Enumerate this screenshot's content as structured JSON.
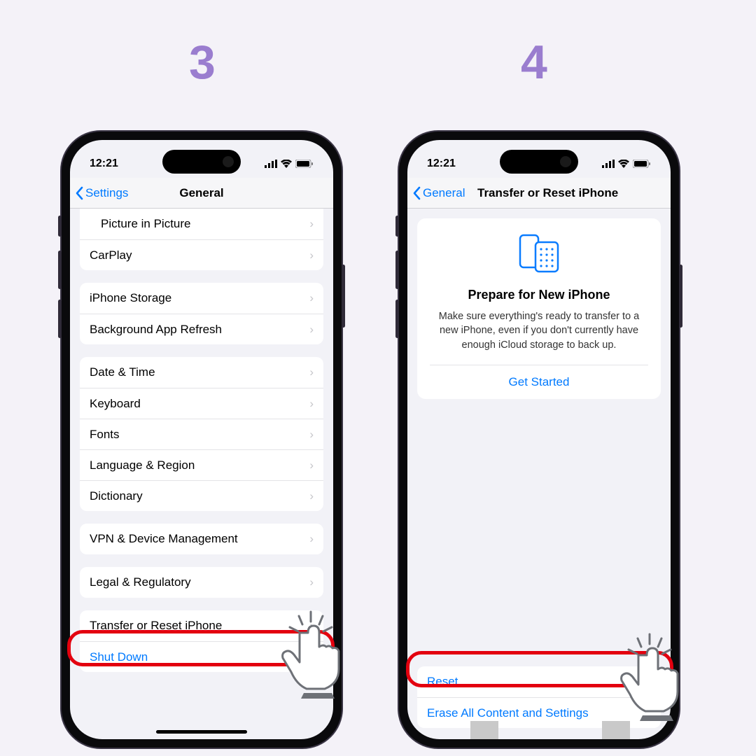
{
  "steps": {
    "s3": "3",
    "s4": "4"
  },
  "status": {
    "time": "12:21"
  },
  "screen3": {
    "back": "Settings",
    "title": "General",
    "g1": [
      "Picture in Picture",
      "CarPlay"
    ],
    "g2": [
      "iPhone Storage",
      "Background App Refresh"
    ],
    "g3": [
      "Date & Time",
      "Keyboard",
      "Fonts",
      "Language & Region",
      "Dictionary"
    ],
    "g4": [
      "VPN & Device Management"
    ],
    "g5": [
      "Legal & Regulatory"
    ],
    "g6": [
      "Transfer or Reset iPhone"
    ],
    "shutdown": "Shut Down"
  },
  "screen4": {
    "back": "General",
    "title": "Transfer or Reset iPhone",
    "hero_title": "Prepare for New iPhone",
    "hero_body": "Make sure everything's ready to transfer to a new iPhone, even if you don't currently have enough iCloud storage to back up.",
    "hero_cta": "Get Started",
    "reset": "Reset",
    "erase": "Erase All Content and Settings"
  }
}
